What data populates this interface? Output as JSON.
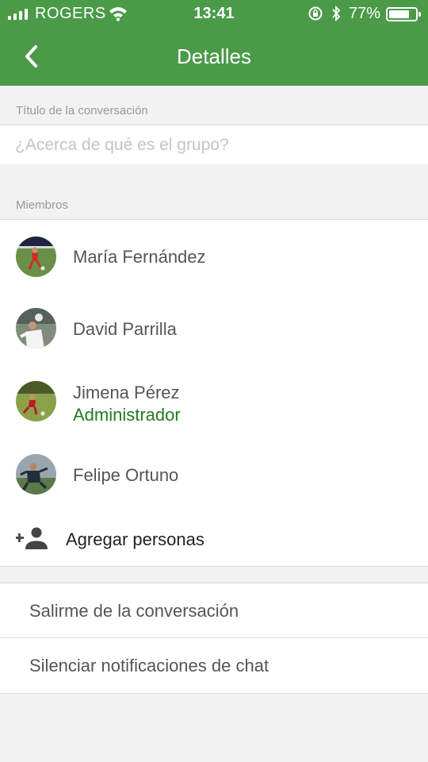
{
  "status_bar": {
    "carrier": "ROGERS",
    "time": "13:41",
    "battery_percent": "77%",
    "battery_level": 0.77
  },
  "nav": {
    "title": "Detalles",
    "back_icon": "chevron-left-icon"
  },
  "conversation": {
    "title_label": "Título de la conversación",
    "title_placeholder": "¿Acerca de qué es el grupo?",
    "title_value": ""
  },
  "members_section": {
    "label": "Miembros",
    "members": [
      {
        "name": "María Fernández",
        "role": ""
      },
      {
        "name": "David Parrilla",
        "role": ""
      },
      {
        "name": "Jimena Pérez",
        "role": "Administrador"
      },
      {
        "name": "Felipe Ortuno",
        "role": ""
      }
    ],
    "add_people_label": "Agregar personas",
    "add_people_icon": "add-person-icon"
  },
  "actions": {
    "leave_label": "Salirme de la conversación",
    "mute_label": "Silenciar notificaciones de chat"
  },
  "colors": {
    "header_bg": "#4a9a48",
    "admin_text": "#237a23",
    "page_bg": "#f2f2f2"
  }
}
